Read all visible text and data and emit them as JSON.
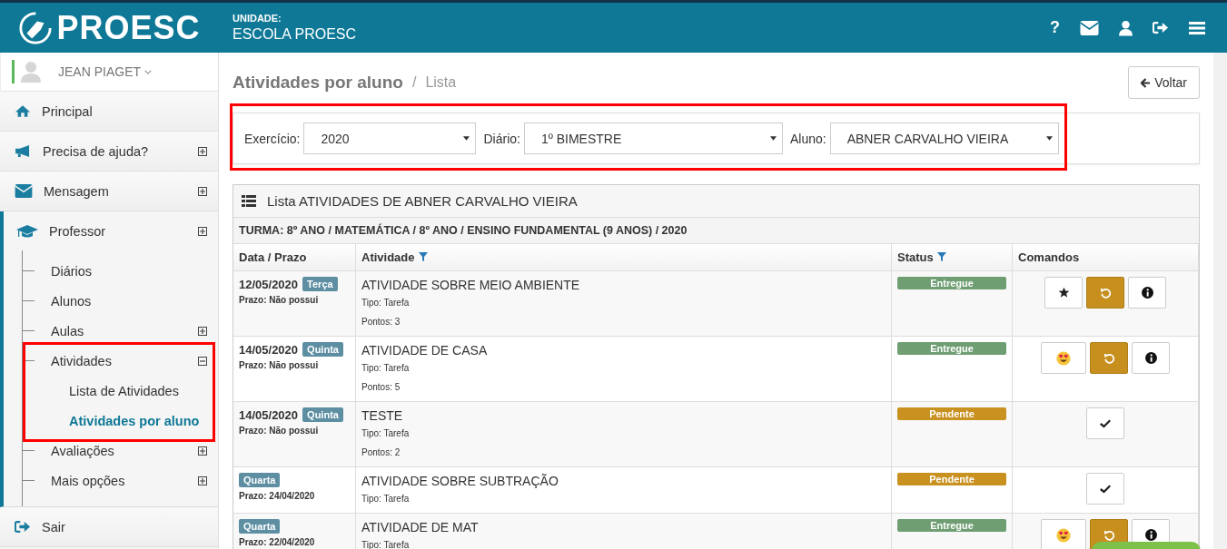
{
  "header": {
    "logo": "PROESC",
    "unit_label": "UNIDADE:",
    "unit_name": "ESCOLA PROESC",
    "help": "?"
  },
  "sidebar": {
    "user": "JEAN PIAGET",
    "items": [
      {
        "label": "Principal"
      },
      {
        "label": "Precisa de ajuda?",
        "expanded": false
      },
      {
        "label": "Mensagem",
        "expanded": false
      },
      {
        "label": "Professor",
        "expanded": false,
        "children": [
          {
            "label": "Diários"
          },
          {
            "label": "Alunos"
          },
          {
            "label": "Aulas",
            "expanded": false
          },
          {
            "label": "Atividades",
            "expanded": true,
            "children": [
              {
                "label": "Lista de Atividades",
                "selected": false
              },
              {
                "label": "Atividades por aluno",
                "selected": true
              }
            ]
          },
          {
            "label": "Avaliações",
            "expanded": false
          },
          {
            "label": "Mais opções",
            "expanded": false
          }
        ]
      },
      {
        "label": "Sair"
      }
    ]
  },
  "page": {
    "title": "Atividades por aluno",
    "separator": "/",
    "breadcrumb": "Lista",
    "back_button": "Voltar"
  },
  "filters": [
    {
      "label": "Exercício:",
      "value": "2020"
    },
    {
      "label": "Diário:",
      "value": "1º BIMESTRE"
    },
    {
      "label": "Aluno:",
      "value": "ABNER CARVALHO VIEIRA"
    }
  ],
  "table": {
    "title": "Lista ATIVIDADES DE ABNER CARVALHO VIEIRA",
    "class_line": "TURMA: 8º ANO / MATEMÁTICA / 8º ANO / ENSINO FUNDAMENTAL (9 ANOS) / 2020",
    "columns": [
      {
        "label": "Data / Prazo",
        "filter": false
      },
      {
        "label": "Atividade",
        "filter": true
      },
      {
        "label": "Status",
        "filter": true
      },
      {
        "label": "Comandos",
        "filter": false
      }
    ],
    "rows": [
      {
        "date": "12/05/2020",
        "day": "Terça",
        "deadline": "Prazo: Não possui",
        "activity": "ATIVIDADE SOBRE MEIO AMBIENTE",
        "type": "Tipo: Tarefa",
        "points": "Pontos: 3",
        "status": {
          "label": "Entregue",
          "color": "#6f9e73"
        },
        "commands": [
          {
            "kind": "star"
          },
          {
            "kind": "undo"
          },
          {
            "kind": "info"
          }
        ]
      },
      {
        "date": "14/05/2020",
        "day": "Quinta",
        "deadline": "Prazo: Não possui",
        "activity": "ATIVIDADE DE CASA",
        "type": "Tipo: Tarefa",
        "points": "Pontos: 5",
        "status": {
          "label": "Entregue",
          "color": "#6f9e73"
        },
        "commands": [
          {
            "kind": "emoji"
          },
          {
            "kind": "undo"
          },
          {
            "kind": "info"
          }
        ]
      },
      {
        "date": "14/05/2020",
        "day": "Quinta",
        "deadline": "Prazo: Não possui",
        "activity": "TESTE",
        "type": "Tipo: Tarefa",
        "points": "Pontos: 2",
        "status": {
          "label": "Pendente",
          "color": "#c89120"
        },
        "commands": [
          {
            "kind": "check"
          }
        ]
      },
      {
        "day": "Quarta",
        "deadline": "Prazo: 24/04/2020",
        "activity": "ATIVIDADE SOBRE SUBTRAÇÃO",
        "type": "Tipo: Tarefa",
        "status": {
          "label": "Pendente",
          "color": "#c89120"
        },
        "commands": [
          {
            "kind": "check"
          }
        ]
      },
      {
        "day": "Quarta",
        "deadline": "Prazo: 22/04/2020",
        "activity": "ATIVIDADE DE MAT",
        "type": "Tipo: Tarefa",
        "status": {
          "label": "Entregue",
          "color": "#6f9e73"
        },
        "commands": [
          {
            "kind": "emoji"
          },
          {
            "kind": "undo"
          },
          {
            "kind": "info"
          }
        ]
      }
    ]
  }
}
